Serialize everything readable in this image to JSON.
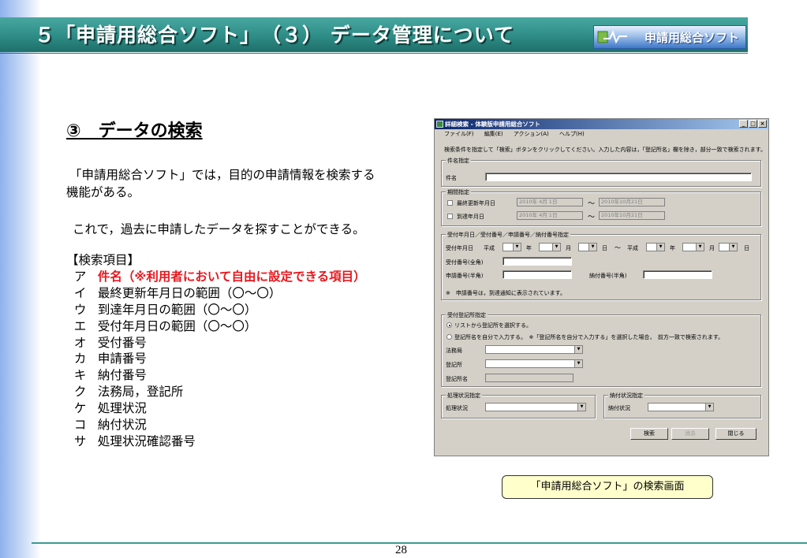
{
  "slide": {
    "title": "５「申請用総合ソフト」　（３） データ管理について",
    "logo_text": "申請用総合ソフト",
    "heading": "③　データの検索",
    "paragraph1_line1": "「申請用総合ソフト」では，目的の申請情報を検索する",
    "paragraph1_line2": "機能がある。",
    "paragraph2": "これで，過去に申請したデータを探すことができる。",
    "items_header": "【検索項目】",
    "items": [
      {
        "marker": "ア",
        "text": "件名（※利用者において自由に設定できる項目）",
        "highlight": true
      },
      {
        "marker": "イ",
        "text": "最終更新年月日の範囲（〇～〇）",
        "highlight": false
      },
      {
        "marker": "ウ",
        "text": "到達年月日の範囲（〇～〇）",
        "highlight": false
      },
      {
        "marker": "エ",
        "text": "受付年月日の範囲（〇～〇）",
        "highlight": false
      },
      {
        "marker": "オ",
        "text": "受付番号",
        "highlight": false
      },
      {
        "marker": "カ",
        "text": "申請番号",
        "highlight": false
      },
      {
        "marker": "キ",
        "text": "納付番号",
        "highlight": false
      },
      {
        "marker": "ク",
        "text": "法務局，登記所",
        "highlight": false
      },
      {
        "marker": "ケ",
        "text": "処理状況",
        "highlight": false
      },
      {
        "marker": "コ",
        "text": "納付状況",
        "highlight": false
      },
      {
        "marker": "サ",
        "text": "処理状況確認番号",
        "highlight": false
      }
    ],
    "caption": "「申請用総合ソフト」の検索画面",
    "page_number": "28"
  },
  "window": {
    "title": "詳細検索 - 体験版申請用総合ソフト",
    "menu": [
      "ファイル(F)",
      "編集(E)",
      "アクション(A)",
      "ヘルプ(H)"
    ],
    "instruction": "検索条件を指定して「検索」ボタンをクリックしてください。入力した内容は，「登記所名」欄を除き，部分一致で検索されます。",
    "subject_group": "件名指定",
    "subject_label": "件名",
    "period_group": "期間指定",
    "last_updated_label": "最終更新年月日",
    "arrival_label": "到達年月日",
    "date_from": "2010年 4月 1日",
    "date_to": "2010年10月21日",
    "tilde": "～",
    "receipt_group": "受付年月日／受付番号／申請番号／納付番号指定",
    "receipt_date_label": "受付年月日",
    "era": "平成",
    "year": "年",
    "month": "月",
    "day": "日",
    "receipt_no_label": "受付番号(全角)",
    "app_no_label": "申請番号(半角)",
    "payment_no_label": "納付番号(半角)",
    "note": "※　申請番号は，到達通知に表示されています。",
    "registry_group": "受付登記所指定",
    "radio_list": "リストから登記所を選択する。",
    "radio_manual": "登記所名を自分で入力する。　※「登記所名を自分で入力する」を選択した場合，　前方一致で検索されます。",
    "bureau_label": "法務局",
    "registry_label": "登記所",
    "registry_name_label": "登記所名",
    "status_group": "処理状況指定",
    "status_label": "処理状況",
    "payment_group": "納付状況指定",
    "payment_label": "納付状況",
    "search_btn": "検索",
    "clear_btn": "消去",
    "close_btn": "閉じる"
  }
}
